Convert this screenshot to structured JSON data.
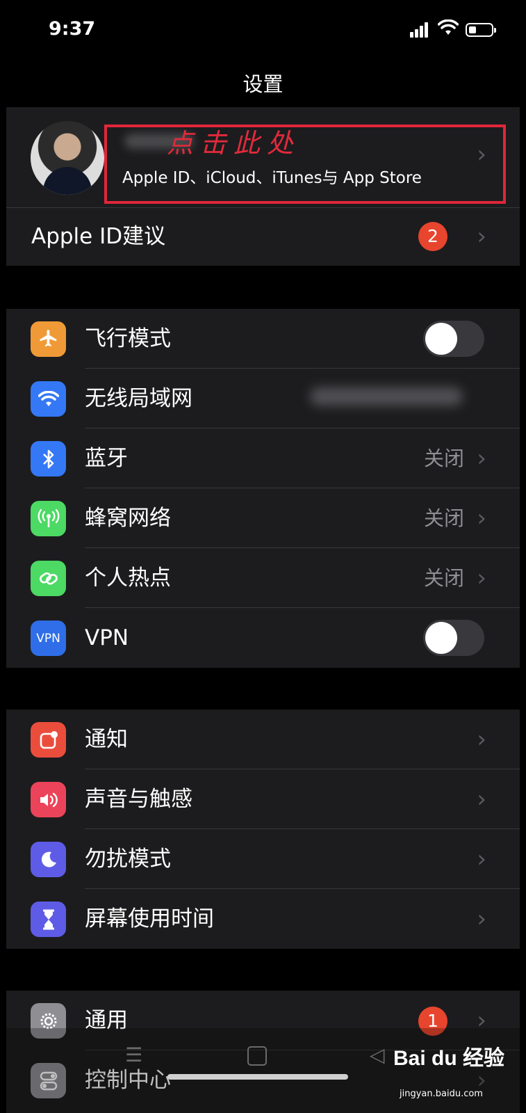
{
  "status_bar": {
    "time": "9:37"
  },
  "nav": {
    "title": "设置"
  },
  "profile": {
    "subtitle": "Apple ID、iCloud、iTunes与 App Store",
    "annotation": "点击此处"
  },
  "apple_id_suggestions": {
    "label": "Apple ID建议",
    "badge": "2"
  },
  "connectivity": [
    {
      "label": "飞行模式",
      "icon": "airplane-icon",
      "color": "#f09a37",
      "toggle": false
    },
    {
      "label": "无线局域网",
      "icon": "wifi-icon",
      "color": "#3478f6"
    },
    {
      "label": "蓝牙",
      "icon": "bluetooth-icon",
      "color": "#3478f6",
      "value": "关闭"
    },
    {
      "label": "蜂窝网络",
      "icon": "cellular-icon",
      "color": "#4cd964",
      "value": "关闭"
    },
    {
      "label": "个人热点",
      "icon": "hotspot-icon",
      "color": "#4cd964",
      "value": "关闭"
    },
    {
      "label": "VPN",
      "icon": "vpn-icon",
      "color": "#2f6ee8",
      "icon_text": "VPN",
      "toggle": false
    }
  ],
  "notifications_group": [
    {
      "label": "通知",
      "icon": "notifications-icon",
      "color": "#eb4d3d"
    },
    {
      "label": "声音与触感",
      "icon": "sound-icon",
      "color": "#eb445a"
    },
    {
      "label": "勿扰模式",
      "icon": "moon-icon",
      "color": "#5e5ce6"
    },
    {
      "label": "屏幕使用时间",
      "icon": "hourglass-icon",
      "color": "#5e5ce6"
    }
  ],
  "general_group": [
    {
      "label": "通用",
      "icon": "gear-icon",
      "color": "#8e8e93",
      "badge": "1"
    },
    {
      "label": "控制中心",
      "icon": "control-center-icon",
      "color": "#8e8e93"
    }
  ],
  "watermark": {
    "brand": "Bai du 经验",
    "url": "jingyan.baidu.com"
  }
}
